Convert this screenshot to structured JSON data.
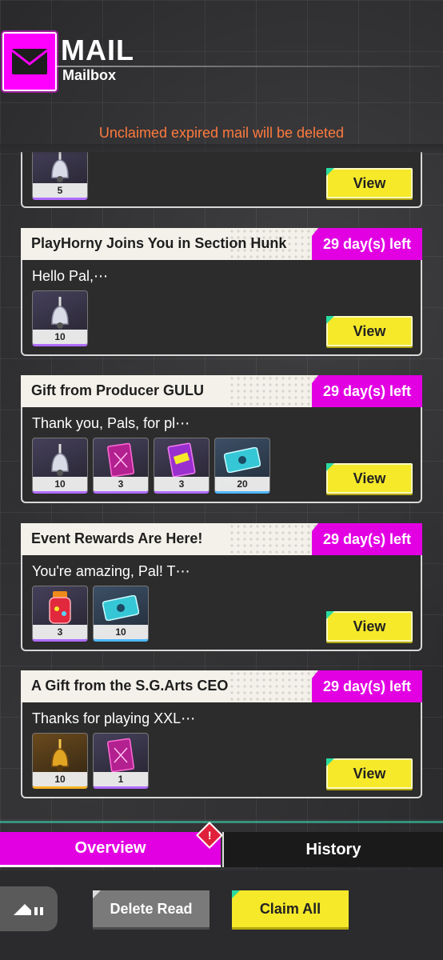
{
  "header": {
    "title": "MAIL",
    "subtitle": "Mailbox",
    "icon": "envelope-icon"
  },
  "notice": "Unclaimed expired mail will be deleted",
  "partial_mail": {
    "items": [
      {
        "icon": "bell-icon",
        "qty": "5",
        "rarity": "purple"
      }
    ],
    "view_label": "View"
  },
  "mails": [
    {
      "title": "PlayHorny Joins You in Section Hunk",
      "days_left": "29 day(s) left",
      "message": "Hello Pal,⋯",
      "view_label": "View",
      "items": [
        {
          "icon": "bell-icon",
          "qty": "10",
          "rarity": "purple"
        }
      ]
    },
    {
      "title": "Gift from Producer GULU",
      "days_left": "29 day(s) left",
      "message": "Thank you, Pals, for pl⋯",
      "view_label": "View",
      "items": [
        {
          "icon": "bell-icon",
          "qty": "10",
          "rarity": "purple"
        },
        {
          "icon": "card-pack-icon",
          "qty": "3",
          "rarity": "purple"
        },
        {
          "icon": "sale-card-icon",
          "qty": "3",
          "rarity": "purple"
        },
        {
          "icon": "ticket-icon",
          "qty": "20",
          "rarity": "blue"
        }
      ]
    },
    {
      "title": "Event Rewards Are Here!",
      "days_left": "29 day(s) left",
      "message": "You're amazing, Pal! T⋯",
      "view_label": "View",
      "items": [
        {
          "icon": "jar-icon",
          "qty": "3",
          "rarity": "purple"
        },
        {
          "icon": "ticket-icon",
          "qty": "10",
          "rarity": "blue"
        }
      ]
    },
    {
      "title": "A Gift from the S.G.Arts CEO",
      "days_left": "29 day(s) left",
      "message": "Thanks for playing XXL⋯",
      "view_label": "View",
      "items": [
        {
          "icon": "gold-bell-icon",
          "qty": "10",
          "rarity": "gold"
        },
        {
          "icon": "card-pack-icon",
          "qty": "1",
          "rarity": "purple"
        }
      ]
    }
  ],
  "tabs": {
    "overview": "Overview",
    "history": "History",
    "alert": "!"
  },
  "actions": {
    "delete_read": "Delete Read",
    "claim_all": "Claim All"
  },
  "colors": {
    "accent_magenta": "#e200e2",
    "button_yellow": "#f5e92a",
    "notice_orange": "#ff7a3d"
  }
}
